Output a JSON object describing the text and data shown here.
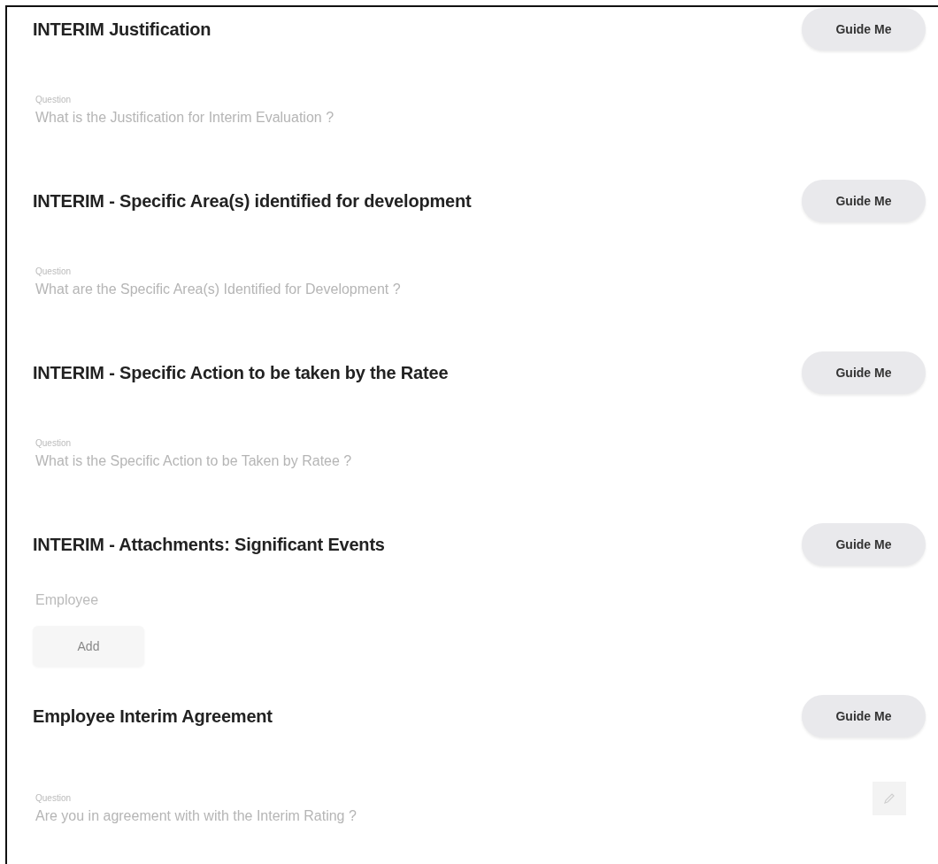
{
  "sections": [
    {
      "kind": "question",
      "title": "INTERIM Justification",
      "button": "Guide Me",
      "label": "Question",
      "question": "What is the Justification for Interim Evaluation ?",
      "editable": false
    },
    {
      "kind": "question",
      "title": "INTERIM - Specific Area(s) identified for development",
      "button": "Guide Me",
      "label": "Question",
      "question": "What are the Specific Area(s) Identified for Development ?",
      "editable": false
    },
    {
      "kind": "question",
      "title": "INTERIM - Specific Action to be taken by the Ratee",
      "button": "Guide Me",
      "label": "Question",
      "question": "What is the Specific Action to be Taken by Ratee ?",
      "editable": false
    },
    {
      "kind": "attachments",
      "title": "INTERIM - Attachments: Significant Events",
      "button": "Guide Me",
      "label": "Employee",
      "add": "Add"
    },
    {
      "kind": "question",
      "title": "Employee Interim Agreement",
      "button": "Guide Me",
      "label": "Question",
      "question": "Are you in agreement with with the Interim Rating ?",
      "editable": true
    }
  ]
}
